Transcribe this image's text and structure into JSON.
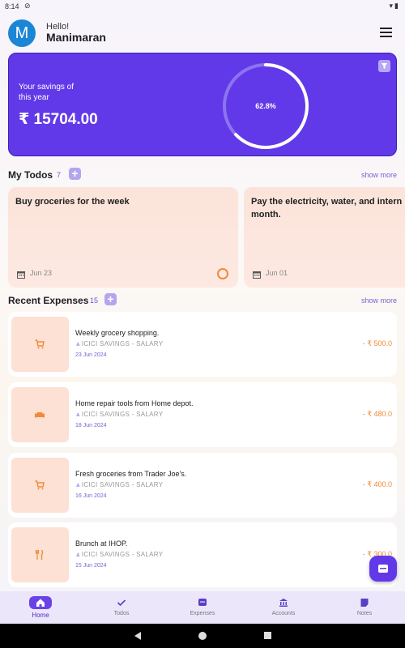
{
  "status_bar": {
    "time": "8:14",
    "status_icons": [
      "sync-icon",
      "wifi-icon",
      "battery-icon"
    ]
  },
  "header": {
    "avatar_letter": "M",
    "greeting": "Hello!",
    "user_name": "Manimaran"
  },
  "savings": {
    "label": "Your savings of this year",
    "amount": "₹ 15704.00",
    "percent_label": "62.8%",
    "progress_fraction": 0.628,
    "card_color": "#6239e9"
  },
  "todos": {
    "title": "My Todos",
    "count": "7",
    "show_more": "show more",
    "items": [
      {
        "title": "Buy groceries for the week",
        "date": "Jun 23"
      },
      {
        "title": "Pay the electricity, water, and internet bills for the month.",
        "title_line1": "Pay the electricity, water, and intern",
        "title_line2": "month.",
        "date": "Jun 01"
      }
    ]
  },
  "expenses": {
    "title": "Recent Expenses",
    "count": "15",
    "show_more": "show more",
    "items": [
      {
        "description": "Weekly grocery shopping.",
        "account": "ICICI SAVINGS - SALARY",
        "date": "23 Jun 2024",
        "amount": "- ₹ 500.0",
        "icon": "cart-icon"
      },
      {
        "description": "Home repair tools from Home depot.",
        "account": "ICICI SAVINGS - SALARY",
        "date": "18 Jun 2024",
        "amount": "- ₹ 480.0",
        "icon": "sofa-icon"
      },
      {
        "description": "Fresh groceries from Trader Joe's.",
        "account": "ICICI SAVINGS - SALARY",
        "date": "16 Jun 2024",
        "amount": "- ₹ 400.0",
        "icon": "cart-icon"
      },
      {
        "description": "Brunch at IHOP.",
        "account": "ICICI SAVINGS - SALARY",
        "date": "15 Jun 2024",
        "amount": "- ₹ 300.0",
        "icon": "fork-knife-icon"
      }
    ]
  },
  "bottom_nav": {
    "items": [
      {
        "label": "Home",
        "icon": "home-icon",
        "active": true
      },
      {
        "label": "Todos",
        "icon": "check-icon",
        "active": false
      },
      {
        "label": "Expenses",
        "icon": "wallet-icon",
        "active": false
      },
      {
        "label": "Accounts",
        "icon": "bank-icon",
        "active": false
      },
      {
        "label": "Notes",
        "icon": "note-icon",
        "active": false
      }
    ]
  },
  "colors": {
    "accent": "#6239e9",
    "expense_amount": "#f08a35",
    "thumb_bg": "#fce1d4",
    "nav_bg": "#ece6fb"
  }
}
